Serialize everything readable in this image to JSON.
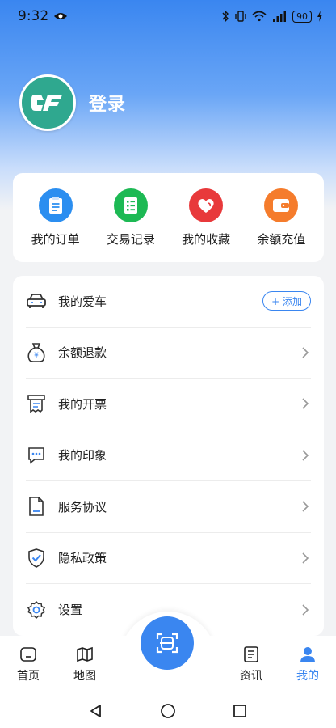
{
  "status_bar": {
    "time": "9:32",
    "battery": "90"
  },
  "profile": {
    "login_label": "登录"
  },
  "quick_actions": [
    {
      "label": "我的订单",
      "icon": "clipboard-icon",
      "color": "#2b8ef0"
    },
    {
      "label": "交易记录",
      "icon": "list-icon",
      "color": "#1db954"
    },
    {
      "label": "我的收藏",
      "icon": "heart-icon",
      "color": "#e8393b"
    },
    {
      "label": "余额充值",
      "icon": "wallet-icon",
      "color": "#f57c2c"
    }
  ],
  "menu": {
    "items": [
      {
        "label": "我的爱车",
        "icon": "car-icon"
      },
      {
        "label": "余额退款",
        "icon": "money-bag-icon"
      },
      {
        "label": "我的开票",
        "icon": "invoice-icon"
      },
      {
        "label": "我的印象",
        "icon": "chat-icon"
      },
      {
        "label": "服务协议",
        "icon": "document-icon"
      },
      {
        "label": "隐私政策",
        "icon": "shield-icon"
      },
      {
        "label": "设置",
        "icon": "gear-icon"
      }
    ],
    "add_label": "+ 添加"
  },
  "tabbar": {
    "tabs": [
      {
        "label": "首页",
        "icon": "home-icon"
      },
      {
        "label": "地图",
        "icon": "map-icon"
      },
      {
        "label": "资讯",
        "icon": "news-icon"
      },
      {
        "label": "我的",
        "icon": "user-icon"
      }
    ],
    "active_tab": "我的",
    "accent": "#3a86f0"
  }
}
